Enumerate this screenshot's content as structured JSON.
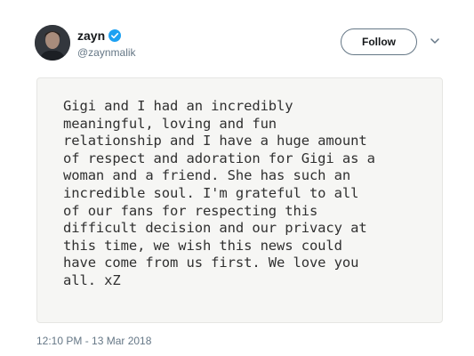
{
  "tweet": {
    "author": {
      "display_name": "zayn",
      "handle": "@zaynmalik",
      "verified": true,
      "verified_color": "#1da1f2"
    },
    "follow_button_label": "Follow",
    "more_icon": "chevron-down-icon",
    "note_text": "Gigi and I had an incredibly\nmeaningful, loving and fun\nrelationship and I have a huge amount\nof respect and adoration for Gigi as a\nwoman and a friend. She has such an\nincredible soul. I'm grateful to all\nof our fans for respecting this\ndifficult decision and our privacy at\nthis time, we wish this news could\nhave come from us first. We love you\nall. xZ",
    "timestamp": "12:10 PM - 13 Mar 2018"
  }
}
